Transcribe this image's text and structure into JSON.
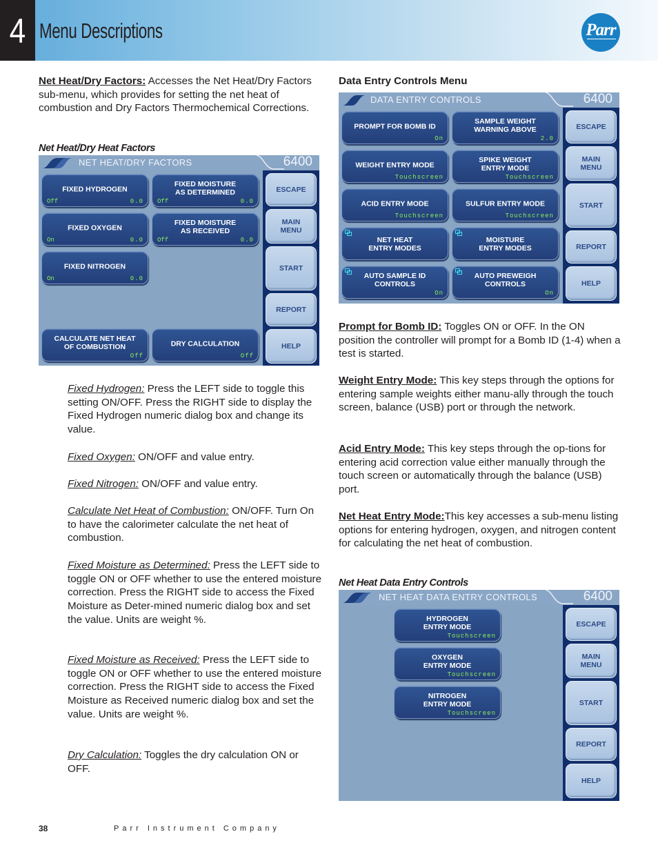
{
  "header": {
    "chapter_number": "4",
    "chapter_title": "Menu Descriptions",
    "logo_text": "Parr",
    "logo_icon": "parr-logo-icon",
    "colors": {
      "chapter_box": "#231f20",
      "gradient_start": "#5eaadb",
      "gradient_end": "#f4f9fd",
      "logo": "#1a80c4"
    }
  },
  "left_column": {
    "intro": {
      "lead": "Net Heat/Dry Factors:",
      "text": "  Accesses the Net Heat/Dry Factors sub-menu, which provides for setting the net heat of combustion and Dry Factors Thermochemical Corrections."
    },
    "screen_caption": "Net Heat/Dry Heat Factors",
    "descriptions": [
      {
        "lead": "Fixed Hydrogen:",
        "text": "  Press the LEFT side to toggle this setting ON/OFF.  Press the RIGHT side to display the Fixed Hydrogen numeric dialog box and change its value."
      },
      {
        "lead": "Fixed Oxygen:",
        "text": "  ON/OFF and value entry."
      },
      {
        "lead": "Fixed Nitrogen:",
        "text": "  ON/OFF and value entry."
      },
      {
        "lead": "Calculate Net Heat of Combustion:",
        "text": "  ON/OFF. Turn On to have the calorimeter calculate the net heat of combustion."
      },
      {
        "lead": "Fixed Moisture as Determined:",
        "text": "  Press the LEFT side to toggle ON or OFF whether to use the entered moisture correction.  Press the RIGHT side to access the Fixed Moisture as Deter-mined numeric dialog box and set the value. Units are weight %."
      },
      {
        "lead": "Fixed Moisture as Received:",
        "text": "  Press the LEFT side to toggle ON or OFF whether to use the entered moisture correction.  Press the RIGHT side to access the Fixed Moisture as Received numeric dialog box and set the value.  Units are weight %."
      },
      {
        "lead": "Dry Calculation:",
        "text": " Toggles the dry calculation ON or OFF."
      }
    ]
  },
  "right_column": {
    "heading": "Data Entry Controls Menu",
    "descriptions": [
      {
        "lead": "Prompt for Bomb ID:",
        "text": " Toggles ON or OFF.  In the ON position the controller will prompt for a Bomb ID (1-4) when a test is started."
      },
      {
        "lead": "Weight Entry Mode:",
        "text": " This key steps through the options for entering sample weights either manu-ally through the touch screen, balance (USB) port or through the network."
      },
      {
        "lead": "Acid Entry Mode:",
        "text": " This key steps through the op-tions for entering acid correction value either manually through the touch screen or automatically through the balance (USB) port."
      },
      {
        "lead": "Net Heat Entry Mode:",
        "text": "This key accesses a sub-menu listing options for entering hydrogen, oxygen, and nitrogen content for calculating the net heat of combustion."
      }
    ],
    "screen2_caption": "Net Heat Data Entry Controls"
  },
  "screens": {
    "net_heat_dry": {
      "title": "NET HEAT/DRY FACTORS",
      "model": "6400",
      "buttons": [
        {
          "label": "FIXED HYDROGEN",
          "left_status": "Off",
          "right_status": "0.0"
        },
        {
          "label": "FIXED MOISTURE\nAS DETERMINED",
          "left_status": "Off",
          "right_status": "0.0"
        },
        {
          "label": "FIXED OXYGEN",
          "left_status": "On",
          "right_status": "0.0"
        },
        {
          "label": "FIXED MOISTURE\nAS RECEIVED",
          "left_status": "Off",
          "right_status": "0.0"
        },
        {
          "label": "FIXED NITROGEN",
          "left_status": "On",
          "right_status": "0.0"
        },
        {
          "label": "CALCULATE NET HEAT\nOF COMBUSTION",
          "right_status": "Off"
        },
        {
          "label": "DRY CALCULATION",
          "right_status": "Off"
        }
      ],
      "side": [
        "ESCAPE",
        "MAIN\nMENU",
        "START",
        "REPORT",
        "HELP"
      ]
    },
    "data_entry": {
      "title": "DATA ENTRY CONTROLS",
      "model": "6400",
      "buttons": [
        {
          "label": "PROMPT FOR BOMB ID",
          "right_status": "On"
        },
        {
          "label": "SAMPLE WEIGHT\nWARNING ABOVE",
          "right_status": "2.0"
        },
        {
          "label": "WEIGHT ENTRY MODE",
          "right_status": "Touchscreen"
        },
        {
          "label": "SPIKE WEIGHT\nENTRY MODE",
          "right_status": "Touchscreen"
        },
        {
          "label": "ACID ENTRY MODE",
          "right_status": "Touchscreen"
        },
        {
          "label": "SULFUR ENTRY MODE",
          "right_status": "Touchscreen"
        },
        {
          "label": "NET HEAT\nENTRY MODES",
          "submenu": true
        },
        {
          "label": "MOISTURE\nENTRY MODES",
          "submenu": true
        },
        {
          "label": "AUTO SAMPLE ID\nCONTROLS",
          "submenu": true,
          "right_status": "On"
        },
        {
          "label": "AUTO PREWEIGH\nCONTROLS",
          "submenu": true,
          "right_status": "On"
        }
      ],
      "side": [
        "ESCAPE",
        "MAIN\nMENU",
        "START",
        "REPORT",
        "HELP"
      ]
    },
    "net_heat_data": {
      "title": "NET HEAT DATA ENTRY CONTROLS",
      "model": "6400",
      "buttons": [
        {
          "label": "HYDROGEN\nENTRY MODE",
          "right_status": "Touchscreen"
        },
        {
          "label": "OXYGEN\nENTRY MODE",
          "right_status": "Touchscreen"
        },
        {
          "label": "NITROGEN\nENTRY MODE",
          "right_status": "Touchscreen"
        }
      ],
      "side": [
        "ESCAPE",
        "MAIN\nMENU",
        "START",
        "REPORT",
        "HELP"
      ]
    },
    "colors": {
      "screen_bg": "#89a5c4",
      "button": "#2a4a88",
      "side_panel": "#102e6b",
      "side_button": "#b6cbe6",
      "status_text": "#8bef5c",
      "submenu_icon": "#3fe0f0"
    }
  },
  "footer": {
    "page_number": "38",
    "company": "Parr Instrument Company"
  }
}
